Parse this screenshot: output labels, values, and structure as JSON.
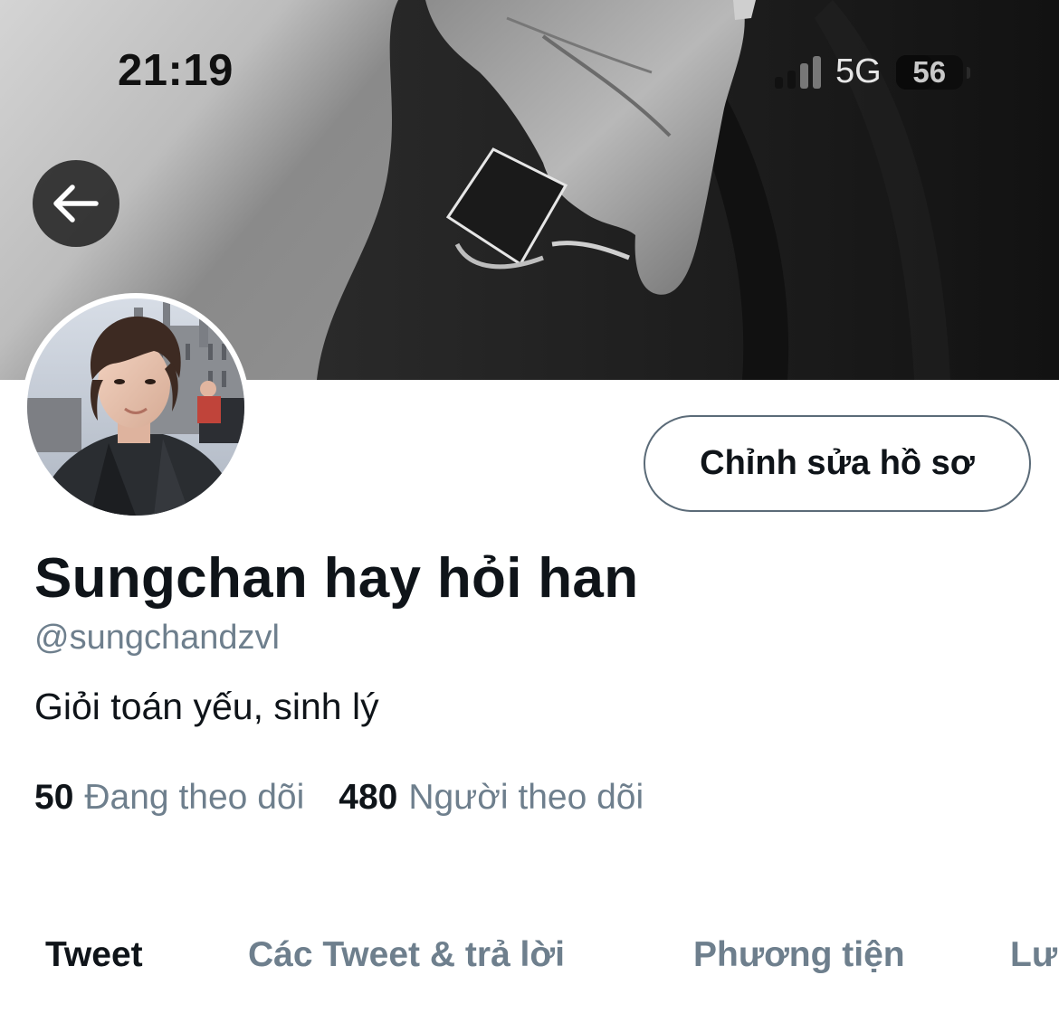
{
  "status_bar": {
    "time": "21:19",
    "network": "5G",
    "battery": "56"
  },
  "profile": {
    "display_name": "Sungchan hay hỏi han",
    "handle": "@sungchandzvl",
    "bio": "Giỏi toán yếu, sinh lý",
    "edit_button_label": "Chỉnh sửa hồ sơ",
    "following_count": "50",
    "following_label": "Đang theo dõi",
    "followers_count": "480",
    "followers_label": "Người theo dõi"
  },
  "tabs": [
    {
      "label": "Tweet",
      "active": true
    },
    {
      "label": "Các Tweet & trả lời",
      "active": false
    },
    {
      "label": "Phương tiện",
      "active": false
    },
    {
      "label": "Lư",
      "active": false
    }
  ],
  "icons": {
    "back": "arrow-left-icon",
    "signal": "cellular-signal-icon",
    "battery": "battery-icon"
  },
  "colors": {
    "text_primary": "#0f1419",
    "text_secondary": "#6e7f8d",
    "button_border": "#5b6b78"
  }
}
